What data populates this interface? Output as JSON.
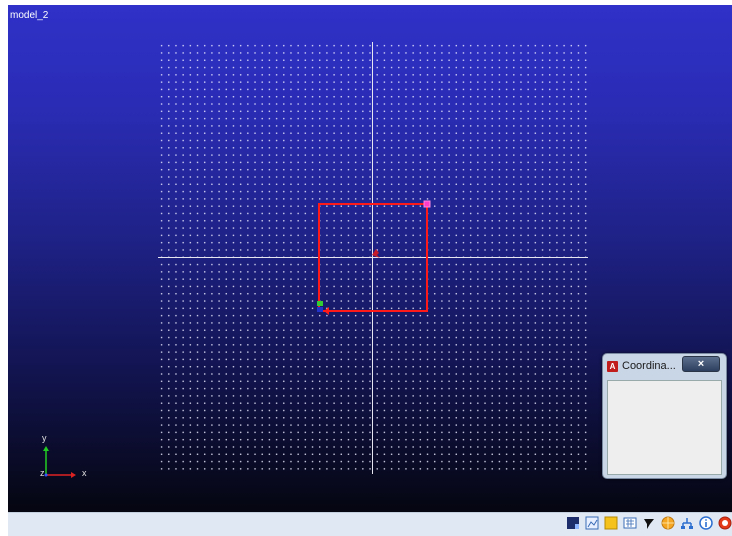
{
  "viewport": {
    "title": "model_2",
    "triad": {
      "y_label": "y",
      "z_label": "z",
      "x_label": "x"
    }
  },
  "coord_window": {
    "title": "Coordina...",
    "app_icon_letter": "A",
    "close_glyph": "×"
  },
  "toolbar": {
    "buttons": [
      {
        "name": "window-icon"
      },
      {
        "name": "chart-icon"
      },
      {
        "name": "sticky-note-icon"
      },
      {
        "name": "calculator-icon"
      },
      {
        "name": "tack-icon"
      },
      {
        "name": "globe-icon"
      },
      {
        "name": "network-icon"
      },
      {
        "name": "info-icon"
      },
      {
        "name": "stop-icon"
      }
    ]
  },
  "colors": {
    "sketch_line": "#ff1a1a",
    "vertex_magenta": "#ff3cc8",
    "vertex_green": "#33cc33"
  }
}
